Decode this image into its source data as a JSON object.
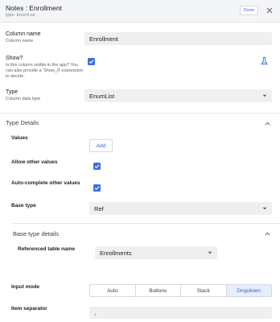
{
  "header": {
    "title": "Notes : Enrollment",
    "subtitle": "type: EnumList",
    "done_label": "Done"
  },
  "column_name": {
    "label": "Column name",
    "help": "Column name",
    "value": "Enrollment"
  },
  "show": {
    "label": "Show?",
    "help": "Is this column visible in the app? You can also provide a 'Show_If' expression to decide.",
    "checked": true
  },
  "type": {
    "label": "Type",
    "help": "Column data type",
    "value": "EnumList"
  },
  "type_details": {
    "title": "Type Details",
    "values_label": "Values",
    "add_label": "Add",
    "allow_other_label": "Allow other values",
    "allow_other_checked": true,
    "autocomplete_label": "Auto-complete other values",
    "autocomplete_checked": true,
    "base_type_label": "Base type",
    "base_type_value": "Ref"
  },
  "base_type_details": {
    "title": "Base type details",
    "ref_table_label": "Referenced table name",
    "ref_table_value": "Enrollments"
  },
  "input_mode": {
    "label": "Input mode",
    "options": [
      "Auto",
      "Buttons",
      "Stack",
      "Dropdown"
    ],
    "selected": "Dropdown"
  },
  "item_separator": {
    "label": "Item separator",
    "value": ","
  },
  "colors": {
    "accent": "#3b6fe0",
    "link": "#2f67d8",
    "header_bg": "#f4f5f7",
    "field_bg": "#efefef",
    "active_segment_bg": "#e6eefb"
  },
  "icons": [
    "close-icon",
    "flask-icon",
    "chevron-up-icon",
    "chevron-down-icon",
    "checkmark-icon"
  ]
}
